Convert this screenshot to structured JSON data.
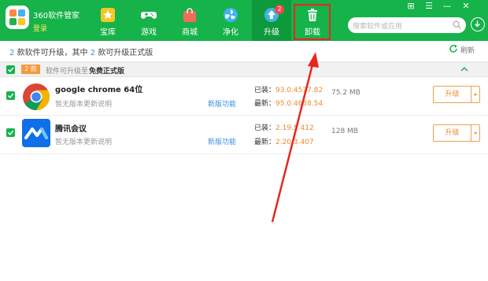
{
  "header": {
    "title": "360软件管家",
    "login": "登录",
    "nav": [
      {
        "label": "宝库",
        "icon": "star-icon"
      },
      {
        "label": "游戏",
        "icon": "gamepad-icon"
      },
      {
        "label": "商城",
        "icon": "shopping-bag-icon"
      },
      {
        "label": "净化",
        "icon": "fan-icon"
      },
      {
        "label": "升级",
        "icon": "upgrade-arrow-icon",
        "badge": "2",
        "active": true
      },
      {
        "label": "卸载",
        "icon": "trash-icon"
      }
    ],
    "window_controls": [
      "⊞",
      "☰",
      "—",
      "✕"
    ],
    "search": {
      "placeholder": "搜索软件或应用"
    }
  },
  "summary": {
    "count_available": "2",
    "text1": "款软件可升级，其中",
    "count_official": "2",
    "text2": "款可升级正式版",
    "refresh": "刷新"
  },
  "group": {
    "badge": "2 款",
    "text": "软件可升级至",
    "bold": "免费正式版"
  },
  "apps": [
    {
      "name": "google chrome 64位",
      "desc": "暂无版本更新说明",
      "new_feature": "新版功能",
      "installed_label": "已装：",
      "installed": "93.0.4577.82",
      "latest_label": "最新：",
      "latest": "95.0.4638.54",
      "size": "75.2 MB",
      "upgrade": "升级"
    },
    {
      "name": "腾讯会议",
      "desc": "暂无版本更新说明",
      "new_feature": "新版功能",
      "installed_label": "已装：",
      "installed": "2.19.5.412",
      "latest_label": "最新：",
      "latest": "2.20.3.407",
      "size": "128 MB",
      "upgrade": "升级"
    }
  ],
  "colors": {
    "header_green": "#16b24a",
    "active_tab": "#0e9a3c",
    "accent_orange": "#f08a2c",
    "link_blue": "#3a8ee6",
    "annotation_red": "#e8261e"
  }
}
